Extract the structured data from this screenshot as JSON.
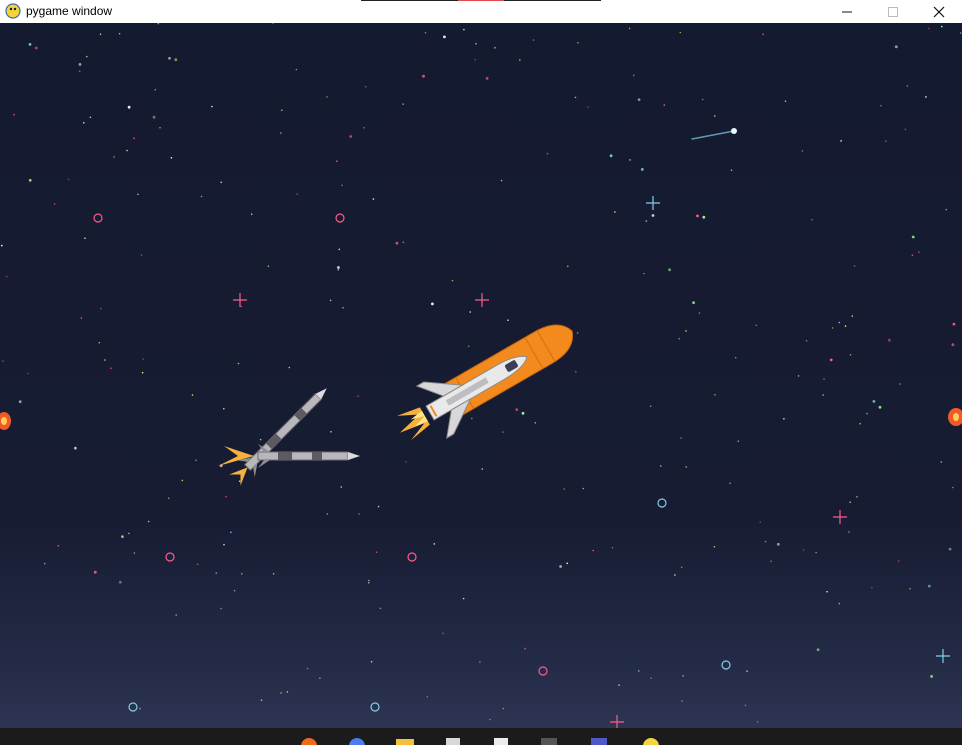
{
  "window": {
    "title": "pygame window",
    "app_icon": "pygame-snake-icon",
    "minimize_icon": "minimize-icon",
    "maximize_icon": "maximize-icon",
    "close_icon": "close-icon"
  },
  "scene": {
    "background_color": "#171c33",
    "star_colors": [
      "#ffe36e",
      "#7fd0e8",
      "#ff5a8a",
      "#9cf29c",
      "#ffffff"
    ],
    "sprites": [
      "space-shuttle",
      "missile",
      "missile",
      "comet",
      "fireball",
      "fireball"
    ]
  },
  "taskbar": {
    "icons": [
      "firefox-icon",
      "app-icon",
      "folder-icon",
      "document-icon",
      "notepad-icon",
      "terminal-icon",
      "teams-icon",
      "pygame-icon"
    ]
  },
  "colors": {
    "titlebar": "#ffffff",
    "shuttle_tank": "#f28a1e",
    "flame": "#f4b23c",
    "taskbar": "#1b1b1b"
  }
}
